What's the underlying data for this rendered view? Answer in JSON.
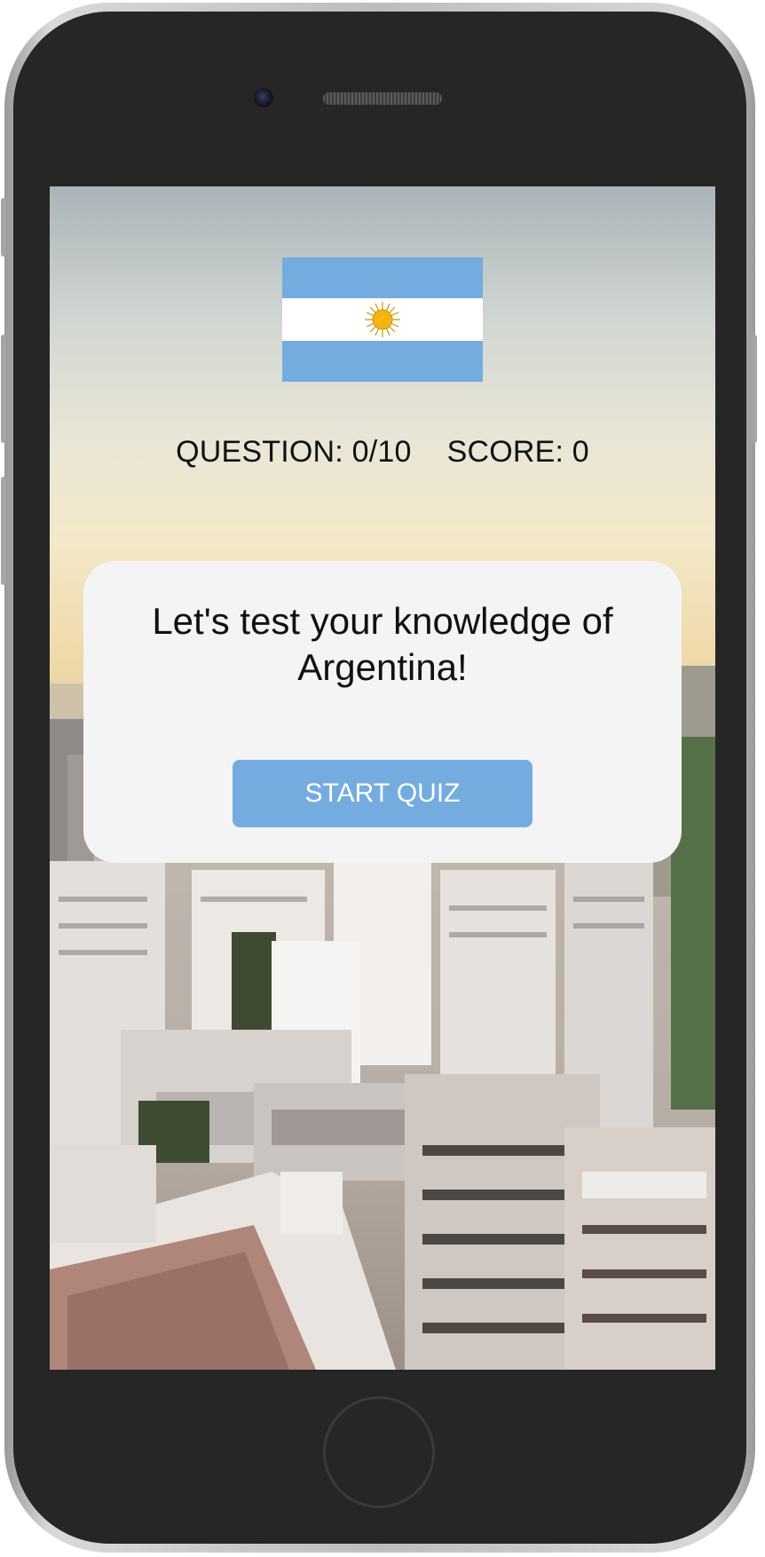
{
  "quiz": {
    "country": "Argentina",
    "question_label": "QUESTION: 0/10",
    "score_label": "SCORE: 0",
    "intro_line1": "Let's test your knowledge of",
    "intro_line2": "Argentina!",
    "start_button": "START QUIZ"
  },
  "progress": {
    "current_question": 0,
    "total_questions": 10,
    "score": 0
  },
  "colors": {
    "accent": "#74ace0",
    "flag_blue": "#74ace0",
    "flag_white": "#ffffff",
    "flag_sun": "#f6b40e",
    "card_background": "#f4f4f4",
    "phone_body": "#262626"
  },
  "icons": {
    "flag": "argentina-flag-icon",
    "sun": "sun-of-may-icon"
  }
}
